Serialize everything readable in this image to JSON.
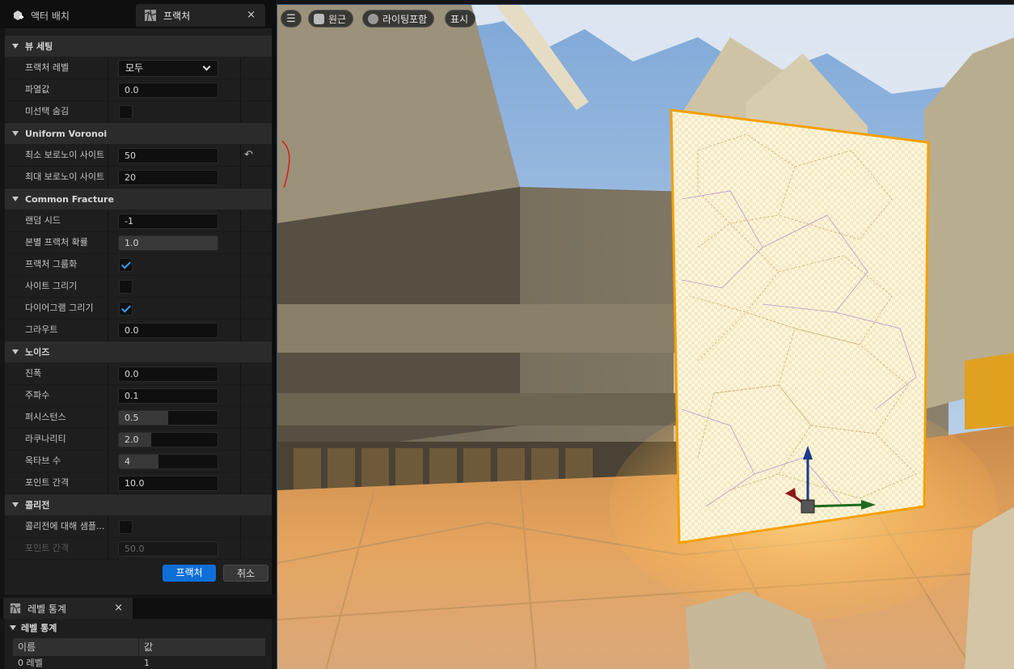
{
  "tabs": {
    "actor_placement": "액터 배치",
    "fracture": "프랙처",
    "close": "×"
  },
  "sections": {
    "view_settings": "뷰 세팅",
    "uniform_voronoi": "Uniform Voronoi",
    "common_fracture": "Common Fracture",
    "noise": "노이즈",
    "collision": "콜리전"
  },
  "rows": {
    "fracture_level": {
      "label": "프랙처 레벨",
      "value": "모두"
    },
    "explode_amount": {
      "label": "파열값",
      "value": "0.0"
    },
    "hide_unselected": {
      "label": "미선택 숨김",
      "checked": false
    },
    "min_voronoi_sites": {
      "label": "최소 보로노이 사이트",
      "value": "50"
    },
    "max_voronoi_sites": {
      "label": "최대 보로노이 사이트",
      "value": "20"
    },
    "random_seed": {
      "label": "랜덤 시드",
      "value": "-1"
    },
    "chance_to_fracture": {
      "label": "본별 프랙처 확률",
      "value": "1.0",
      "fill": 1.0
    },
    "group_fracture": {
      "label": "프랙처 그룹화",
      "checked": true
    },
    "draw_sites": {
      "label": "사이트 그리기",
      "checked": false
    },
    "draw_diagram": {
      "label": "다이어그램 그리기",
      "checked": true
    },
    "grout": {
      "label": "그라우트",
      "value": "0.0"
    },
    "amplitude": {
      "label": "진폭",
      "value": "0.0"
    },
    "frequency": {
      "label": "주파수",
      "value": "0.1"
    },
    "persistence": {
      "label": "퍼시스턴스",
      "value": "0.5",
      "fill": 0.5
    },
    "lacunarity": {
      "label": "라쿠나리티",
      "value": "2.0",
      "fill": 0.33
    },
    "octave_count": {
      "label": "옥타브 수",
      "value": "4",
      "fill": 0.4
    },
    "point_spacing": {
      "label": "포인트 간격",
      "value": "10.0"
    },
    "sample_for_collision": {
      "label": "콜리전에 대해 샘플...",
      "checked": false
    },
    "collision_point_spacing": {
      "label": "포인트 간격",
      "value": "50.0"
    }
  },
  "buttons": {
    "fracture": "프랙처",
    "cancel": "취소",
    "reset": "↶"
  },
  "level_stats": {
    "tab": "레벨 통계",
    "section": "레벨 통계",
    "columns": [
      "이름",
      "값"
    ],
    "rows": [
      [
        "0 레벨",
        "1"
      ]
    ]
  },
  "viewport": {
    "menu_icon": "hamburger-icon",
    "perspective": "원근",
    "lighting": "라이팅포함",
    "show": "표시"
  },
  "colors": {
    "accent": "#0e6fd8",
    "check": "#3b9cf0",
    "selection_outline": "#f5a000"
  }
}
